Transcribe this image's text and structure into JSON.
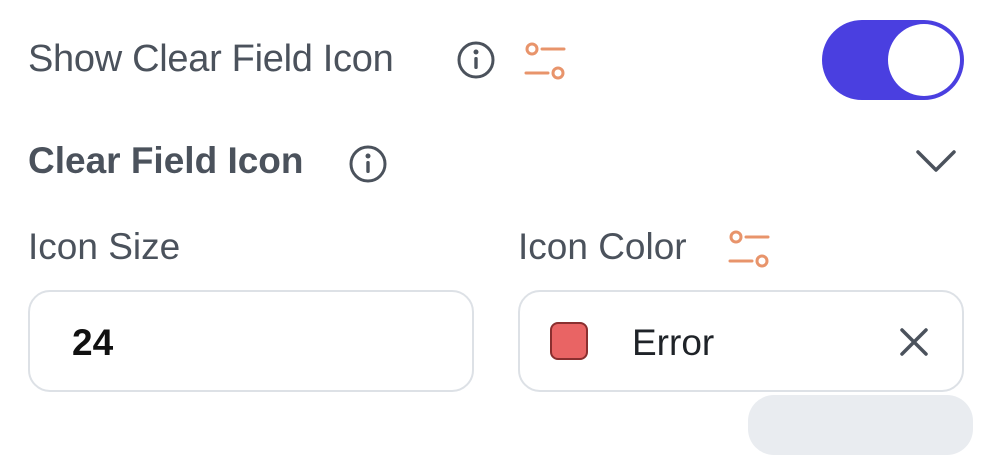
{
  "colors": {
    "accent": "#4a3fe0",
    "variable_icon": "#e8946b",
    "error_swatch": "#e96464"
  },
  "show_clear_field_icon": {
    "label": "Show Clear Field Icon",
    "enabled": true
  },
  "clear_field_icon": {
    "label": "Clear Field Icon",
    "expanded": true
  },
  "icon_size": {
    "label": "Icon Size",
    "value": "24"
  },
  "icon_color": {
    "label": "Icon Color",
    "value": "Error",
    "swatch": "#e96464"
  }
}
